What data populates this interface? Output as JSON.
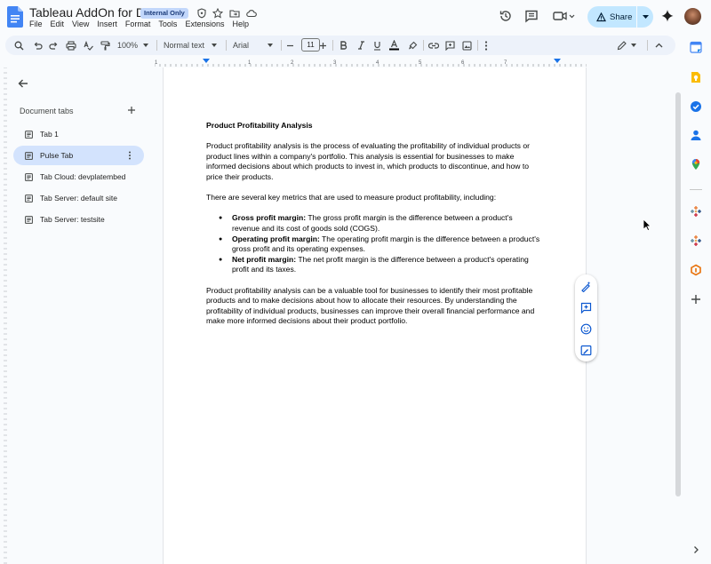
{
  "app": {
    "title": "Tableau AddOn for Docs",
    "badge": "Internal Only",
    "menu": [
      "File",
      "Edit",
      "View",
      "Insert",
      "Format",
      "Tools",
      "Extensions",
      "Help"
    ],
    "share_label": "Share"
  },
  "toolbar": {
    "zoom": "100%",
    "style": "Normal text",
    "font": "Arial",
    "font_size": "11"
  },
  "sidebar": {
    "header": "Document tabs",
    "tabs": [
      {
        "label": "Tab 1",
        "active": false
      },
      {
        "label": "Pulse Tab",
        "active": true
      },
      {
        "label": "Tab Cloud: devplatembed",
        "active": false
      },
      {
        "label": "Tab Server: default site",
        "active": false
      },
      {
        "label": "Tab Server: testsite",
        "active": false
      }
    ]
  },
  "document": {
    "heading": "Product Profitability Analysis",
    "para1": "Product profitability analysis is the process of evaluating the profitability of individual products or product lines within a company's portfolio. This analysis is essential for businesses to make informed decisions about which products to invest in, which products to discontinue, and how to price their products.",
    "para2": "There are several key metrics that are used to measure product profitability, including:",
    "bullets": [
      {
        "term": "Gross profit margin:",
        "text": " The gross profit margin is the difference between a product's revenue and its cost of goods sold (COGS)."
      },
      {
        "term": "Operating profit margin:",
        "text": " The operating profit margin is the difference between a product's gross profit and its operating expenses."
      },
      {
        "term": "Net profit margin:",
        "text": " The net profit margin is the difference between a product's operating profit and its taxes."
      }
    ],
    "para3": "Product profitability analysis can be a valuable tool for businesses to identify their most profitable products and to make decisions about how to allocate their resources. By understanding the profitability of individual products, businesses can improve their overall financial performance and make more informed decisions about their product portfolio."
  },
  "colors": {
    "accent": "#0b57d0",
    "share_bg": "#c2e7ff",
    "active_tab_bg": "#d3e3fd",
    "badge_bg": "#c2d7fb"
  }
}
